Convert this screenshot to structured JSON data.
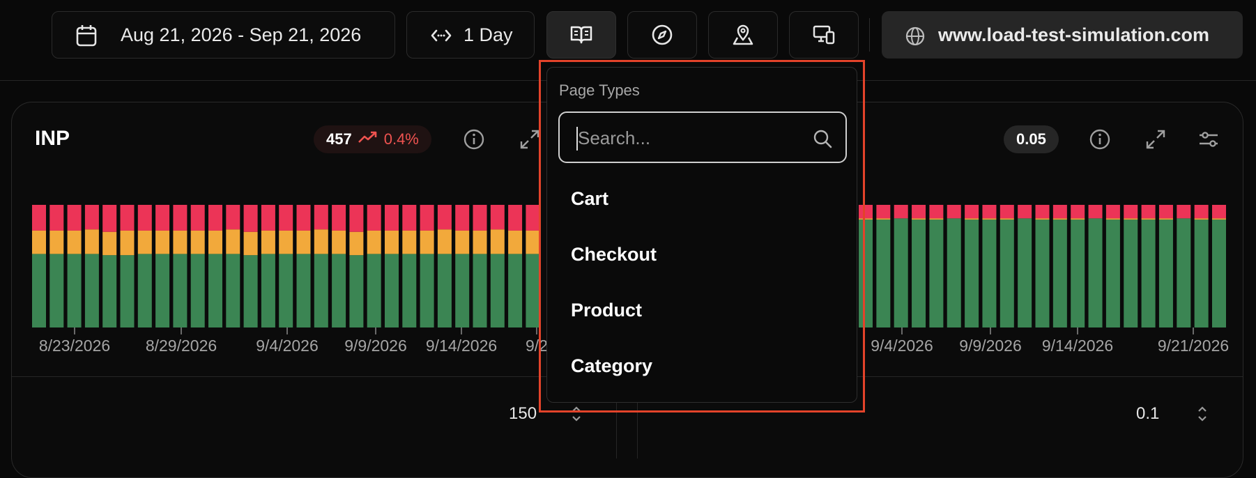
{
  "toolbar": {
    "date_range": "Aug 21, 2026 - Sep 21, 2026",
    "granularity": "1 Day",
    "site": "www.load-test-simulation.com",
    "icons": [
      "calendar-icon",
      "code-arrows-icon",
      "book-open-icon",
      "compass-icon",
      "map-pin-icon",
      "devices-icon",
      "globe-icon"
    ]
  },
  "inp_card": {
    "title": "INP",
    "value": "457",
    "delta": "0.4%",
    "delta_color": "#ef5350",
    "stepper_value": "150",
    "x_ticks": [
      "8/23/2026",
      "8/29/2026",
      "9/4/2026",
      "9/9/2026",
      "9/14/2026",
      "9/2"
    ]
  },
  "cls_card": {
    "value": "0.05",
    "stepper_value": "0.1",
    "x_ticks": [
      "9/4/2026",
      "9/9/2026",
      "9/14/2026",
      "9/21/2026"
    ]
  },
  "dropdown": {
    "header": "Page Types",
    "search_placeholder": "Search...",
    "options": [
      "Cart",
      "Checkout",
      "Product",
      "Category"
    ]
  },
  "colors": {
    "good": "#3b8553",
    "needs_improvement": "#f2a93b",
    "poor": "#ec3457",
    "highlight": "#e3432a"
  },
  "chart_data": [
    {
      "type": "bar",
      "stacked": true,
      "title": "INP",
      "categories_visible": 29,
      "series": [
        {
          "name": "good",
          "values": [
            60,
            60,
            60,
            60,
            59,
            59,
            60,
            60,
            60,
            60,
            60,
            60,
            59,
            60,
            60,
            60,
            60,
            60,
            59,
            60,
            60,
            60,
            60,
            60,
            60,
            60,
            60,
            60,
            60
          ]
        },
        {
          "name": "needs_improvement",
          "values": [
            19,
            19,
            19,
            20,
            19,
            20,
            19,
            19,
            19,
            19,
            19,
            20,
            19,
            19,
            19,
            19,
            20,
            19,
            19,
            19,
            19,
            19,
            19,
            20,
            19,
            19,
            20,
            19,
            19
          ]
        },
        {
          "name": "poor",
          "values": [
            21,
            21,
            21,
            20,
            22,
            21,
            21,
            21,
            21,
            21,
            21,
            20,
            22,
            21,
            21,
            21,
            20,
            21,
            22,
            21,
            21,
            21,
            21,
            20,
            21,
            21,
            20,
            21,
            21
          ]
        }
      ],
      "x_tick_labels": [
        "8/23/2026",
        "8/29/2026",
        "9/4/2026",
        "9/9/2026",
        "9/14/2026",
        "9/2"
      ],
      "ylim": [
        0,
        100
      ]
    },
    {
      "type": "bar",
      "stacked": true,
      "categories_visible": 21,
      "series": [
        {
          "name": "good",
          "values": [
            88,
            88,
            89,
            88,
            88,
            89,
            88,
            88,
            88,
            89,
            88,
            88,
            88,
            89,
            88,
            88,
            88,
            88,
            89,
            88,
            88
          ]
        },
        {
          "name": "needs_improvement",
          "values": [
            1,
            1,
            0,
            1,
            1,
            0,
            1,
            1,
            1,
            0,
            1,
            1,
            1,
            0,
            1,
            1,
            1,
            1,
            0,
            1,
            1
          ]
        },
        {
          "name": "poor",
          "values": [
            11,
            11,
            11,
            11,
            11,
            11,
            11,
            11,
            11,
            11,
            11,
            11,
            11,
            11,
            11,
            11,
            11,
            11,
            11,
            11,
            11
          ]
        }
      ],
      "x_tick_labels": [
        "9/4/2026",
        "9/9/2026",
        "9/14/2026",
        "9/21/2026"
      ],
      "ylim": [
        0,
        100
      ]
    }
  ]
}
